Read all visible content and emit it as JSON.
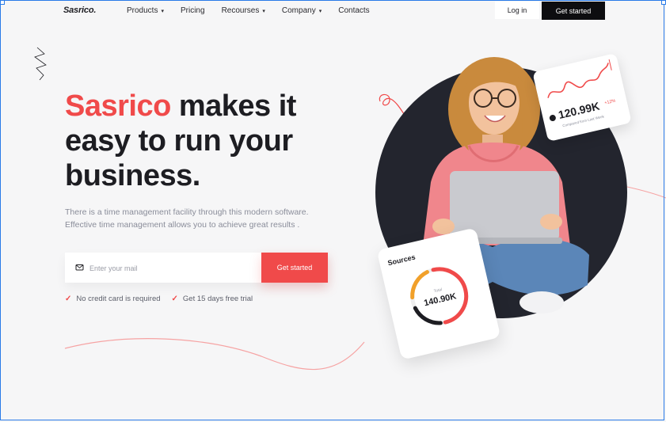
{
  "nav": {
    "logo": "Sasrico.",
    "items": [
      {
        "label": "Products",
        "has_dropdown": true
      },
      {
        "label": "Pricing",
        "has_dropdown": false
      },
      {
        "label": "Recourses",
        "has_dropdown": true
      },
      {
        "label": "Company",
        "has_dropdown": true
      },
      {
        "label": "Contacts",
        "has_dropdown": false
      }
    ],
    "caret": "▾",
    "login_label": "Log in",
    "cta_label": "Get started"
  },
  "hero": {
    "title_brand": "Sasrico",
    "title_rest_1": " makes it",
    "title_line_2": "easy to run your",
    "title_line_3": "business.",
    "desc_line_1": "There is a time management facility through this modern software.",
    "desc_line_2": "Effective time management allows you to achieve great results .",
    "email_placeholder": "Enter your mail",
    "cta_label": "Get started",
    "perks": [
      "No credit card is required",
      "Get 15 days free trial"
    ],
    "check_glyph": "✓"
  },
  "stat_card": {
    "value": "120.99K",
    "change": "+12%",
    "subtitle": "Compared from Last Week",
    "icon": "arrow-up-icon"
  },
  "sources_card": {
    "title": "Sources",
    "total_label": "Total",
    "total_value": "140.90K"
  },
  "colors": {
    "brand": "#f04a4a",
    "dark": "#0d0d10",
    "circle": "#23252e",
    "hoodie": "#f0868c",
    "jeans": "#5b86b8",
    "laptop": "#c9cacf",
    "ring_orange": "#f1a02a",
    "ring_red": "#f04a4a",
    "ring_dark": "#1d1d22"
  }
}
